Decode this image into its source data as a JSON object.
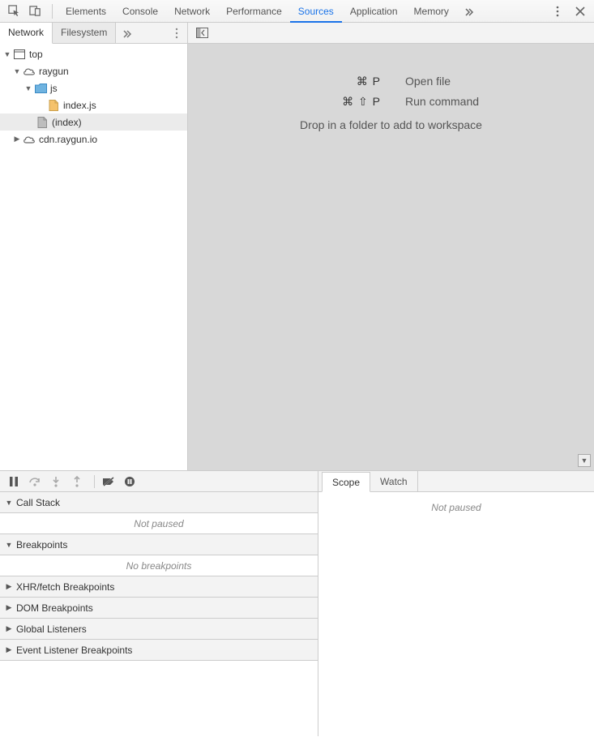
{
  "top_tabs": {
    "elements": "Elements",
    "console": "Console",
    "network": "Network",
    "performance": "Performance",
    "sources": "Sources",
    "application": "Application",
    "memory": "Memory"
  },
  "side_tabs": {
    "network": "Network",
    "filesystem": "Filesystem"
  },
  "tree": {
    "top": "top",
    "raygun": "raygun",
    "js": "js",
    "indexjs": "index.js",
    "index": "(index)",
    "cdn": "cdn.raygun.io"
  },
  "editor": {
    "open_file_keys": "⌘ P",
    "open_file_label": "Open file",
    "run_cmd_keys": "⌘ ⇧ P",
    "run_cmd_label": "Run command",
    "drop_hint": "Drop in a folder to add to workspace"
  },
  "debug_sections": {
    "call_stack": "Call Stack",
    "call_stack_body": "Not paused",
    "breakpoints": "Breakpoints",
    "breakpoints_body": "No breakpoints",
    "xhr_bp": "XHR/fetch Breakpoints",
    "dom_bp": "DOM Breakpoints",
    "global_listeners": "Global Listeners",
    "event_bp": "Event Listener Breakpoints"
  },
  "scope": {
    "scope_tab": "Scope",
    "watch_tab": "Watch",
    "body": "Not paused"
  }
}
